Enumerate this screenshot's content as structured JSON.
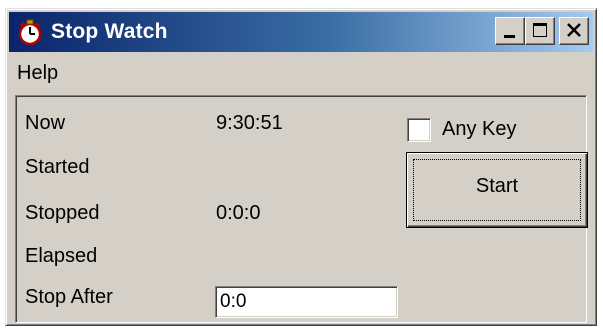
{
  "window": {
    "title": "Stop Watch",
    "icon": "stopwatch-icon",
    "caption_buttons": [
      "minimize",
      "maximize",
      "close"
    ]
  },
  "menu": {
    "items": [
      {
        "label": "Help"
      }
    ]
  },
  "rows": {
    "now_label": "Now",
    "now_value": "9:30:51",
    "started_label": "Started",
    "stopped_label": "Stopped",
    "stopped_value": "0:0:0",
    "elapsed_label": "Elapsed",
    "stop_after_label": "Stop After",
    "stop_after_value": "0:0"
  },
  "controls": {
    "any_key_label": "Any Key",
    "any_key_checked": false,
    "start_label": "Start"
  },
  "colors": {
    "title_gradient_start": "#0a246a",
    "title_gradient_end": "#a6caf0",
    "face": "#d4d0c8"
  }
}
